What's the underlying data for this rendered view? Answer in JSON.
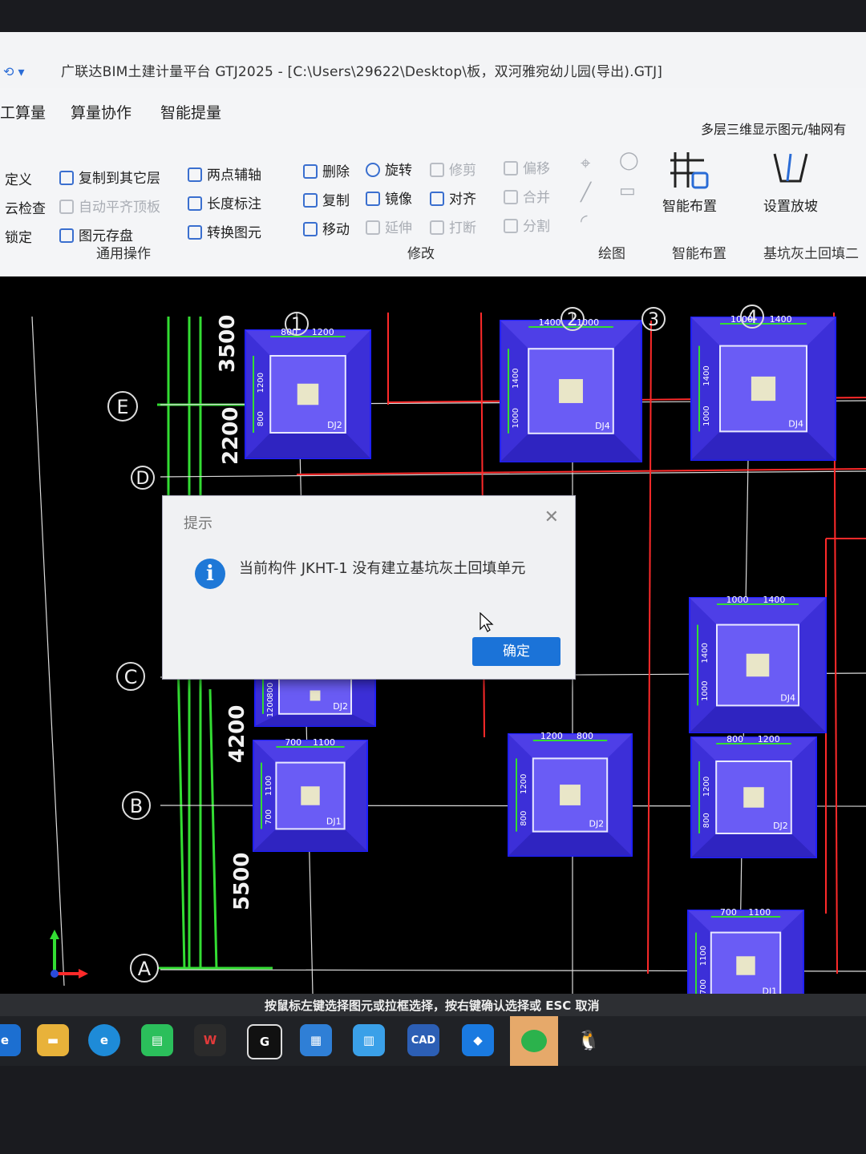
{
  "window": {
    "title": "广联达BIM土建计量平台 GTJ2025 - [C:\\Users\\29622\\Desktop\\板，双河雅宛幼儿园(导出).GTJ]"
  },
  "ribbon": {
    "tabs": [
      "工算量",
      "算量协作",
      "智能提量"
    ],
    "top_right_text": "多层三维显示图元/轴网有",
    "col1": [
      "定义",
      "云检查",
      "锁定"
    ],
    "col2": [
      "复制到其它层",
      "自动平齐顶板",
      "图元存盘"
    ],
    "col3": [
      "两点辅轴",
      "长度标注",
      "转换图元"
    ],
    "col4": [
      "删除",
      "复制",
      "移动"
    ],
    "col5": [
      "旋转",
      "镜像",
      "延伸"
    ],
    "col6": [
      "修剪",
      "对齐",
      "打断"
    ],
    "col7": [
      "偏移",
      "合并",
      "分割"
    ],
    "group_general": "通用操作",
    "group_modify": "修改",
    "group_draw": "绘图",
    "group_smart": "智能布置",
    "group_backfill": "基坑灰土回填二",
    "btn_smart_layout": "智能布置",
    "btn_set_slope": "设置放坡"
  },
  "cad": {
    "axis_numbers": [
      "1",
      "2",
      "3",
      "4"
    ],
    "axis_letters": [
      "E",
      "D",
      "C",
      "B",
      "A"
    ],
    "dims": [
      "3500",
      "2200",
      "4200",
      "5500"
    ],
    "footings": [
      {
        "label": "DJ2",
        "d1": "800",
        "d2": "1200",
        "s1": "1200",
        "s2": "800"
      },
      {
        "label": "DJ4",
        "d1": "1400",
        "d2": "1000",
        "s1": "1400",
        "s2": "1000"
      },
      {
        "label": "DJ4",
        "d1": "1000",
        "d2": "1400",
        "s1": "1400",
        "s2": "1000"
      },
      {
        "label": "DJ4",
        "d1": "1000",
        "d2": "1400",
        "s1": "1400",
        "s2": "1000"
      },
      {
        "label": "DJ2",
        "d1": "800",
        "d2": "1200",
        "s1": "800",
        "s2": "1200"
      },
      {
        "label": "DJ1",
        "d1": "700",
        "d2": "1100",
        "s1": "1100",
        "s2": "700"
      },
      {
        "label": "DJ2",
        "d1": "1200",
        "d2": "800",
        "s1": "1200",
        "s2": "800"
      },
      {
        "label": "DJ2",
        "d1": "800",
        "d2": "1200",
        "s1": "1200",
        "s2": "800"
      },
      {
        "label": "DJ1",
        "d1": "700",
        "d2": "1100",
        "s1": "1100",
        "s2": "700"
      }
    ]
  },
  "dialog": {
    "title": "提示",
    "message": "当前构件 JKHT-1 没有建立基坑灰土回填单元",
    "ok_label": "确定"
  },
  "status_bar": "按鼠标左键选择图元或拉框选择，按右键确认选择或 ESC 取消",
  "taskbar": {
    "icons": [
      "edge-legacy-icon",
      "file-explorer-icon",
      "edge-icon",
      "green-app-icon",
      "wps-icon",
      "g-app-icon",
      "doc-app-icon",
      "files-app-icon",
      "cad-icon",
      "app-icon",
      "wechat-icon",
      "qq-icon"
    ],
    "cad_label": "CAD"
  },
  "colors": {
    "footing_fill": "#3c2fd8",
    "axis_line": "#ff2a2a",
    "dim_line": "#33dd33",
    "ok_button": "#1b73d8"
  }
}
